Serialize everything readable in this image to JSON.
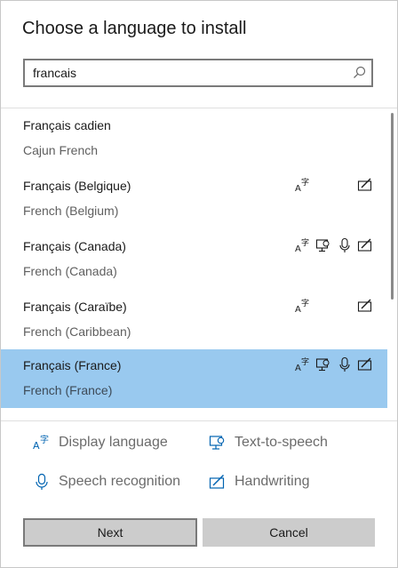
{
  "dialog": {
    "title": "Choose a language to install"
  },
  "search": {
    "value": "francais",
    "icon": "search-icon"
  },
  "languages": [
    {
      "native": "Français cadien",
      "english": "Cajun French",
      "features": [],
      "selected": false
    },
    {
      "native": "Français (Belgique)",
      "english": "French (Belgium)",
      "features": [
        "display-language",
        "handwriting"
      ],
      "selected": false
    },
    {
      "native": "Français (Canada)",
      "english": "French (Canada)",
      "features": [
        "display-language",
        "text-to-speech",
        "speech-recognition",
        "handwriting"
      ],
      "selected": false
    },
    {
      "native": "Français (Caraïbe)",
      "english": "French (Caribbean)",
      "features": [
        "display-language",
        "handwriting"
      ],
      "selected": false
    },
    {
      "native": "Français (France)",
      "english": "French (France)",
      "features": [
        "display-language",
        "text-to-speech",
        "speech-recognition",
        "handwriting"
      ],
      "selected": true
    }
  ],
  "legend": {
    "display_language": "Display language",
    "text_to_speech": "Text-to-speech",
    "speech_recognition": "Speech recognition",
    "handwriting": "Handwriting"
  },
  "buttons": {
    "next": "Next",
    "cancel": "Cancel"
  },
  "colors": {
    "selected_row": "#99c9ef",
    "accent_icon": "#0063b1",
    "button_bg": "#cccccc"
  }
}
